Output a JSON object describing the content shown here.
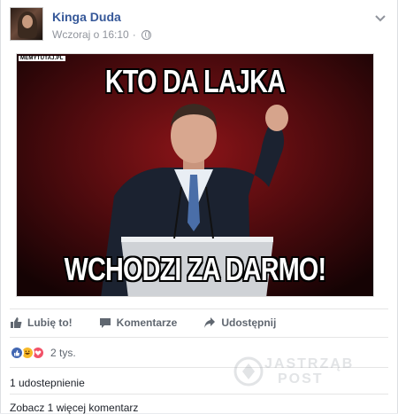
{
  "post": {
    "author": "Kinga Duda",
    "timestamp": "Wczoraj o 16:10",
    "audience_icon": "globe-icon",
    "options_icon": "chevron-down-icon"
  },
  "meme": {
    "watermark": "MEMYTUTAJ.PL",
    "caption_top": "KTO DA LAJKA",
    "caption_bottom": "WCHODZI ZA DARMO!"
  },
  "actions": [
    {
      "label": "Lubię to!",
      "icon": "thumbs-up-icon"
    },
    {
      "label": "Komentarze",
      "icon": "comment-icon"
    },
    {
      "label": "Udostępnij",
      "icon": "share-icon"
    }
  ],
  "reactions": {
    "types": [
      "like",
      "haha",
      "love"
    ],
    "count": "2 tys."
  },
  "shares_text": "1 udostepnienie",
  "more_comments_text": "Zobacz 1 więcej komentarz",
  "watermark_site": {
    "line1": "JASTRZĄB",
    "line2": "POST"
  },
  "colors": {
    "link_blue": "#365899",
    "meta_gray": "#90949c",
    "like_blue": "#4267b2",
    "meme_bg": "#2a0608"
  }
}
